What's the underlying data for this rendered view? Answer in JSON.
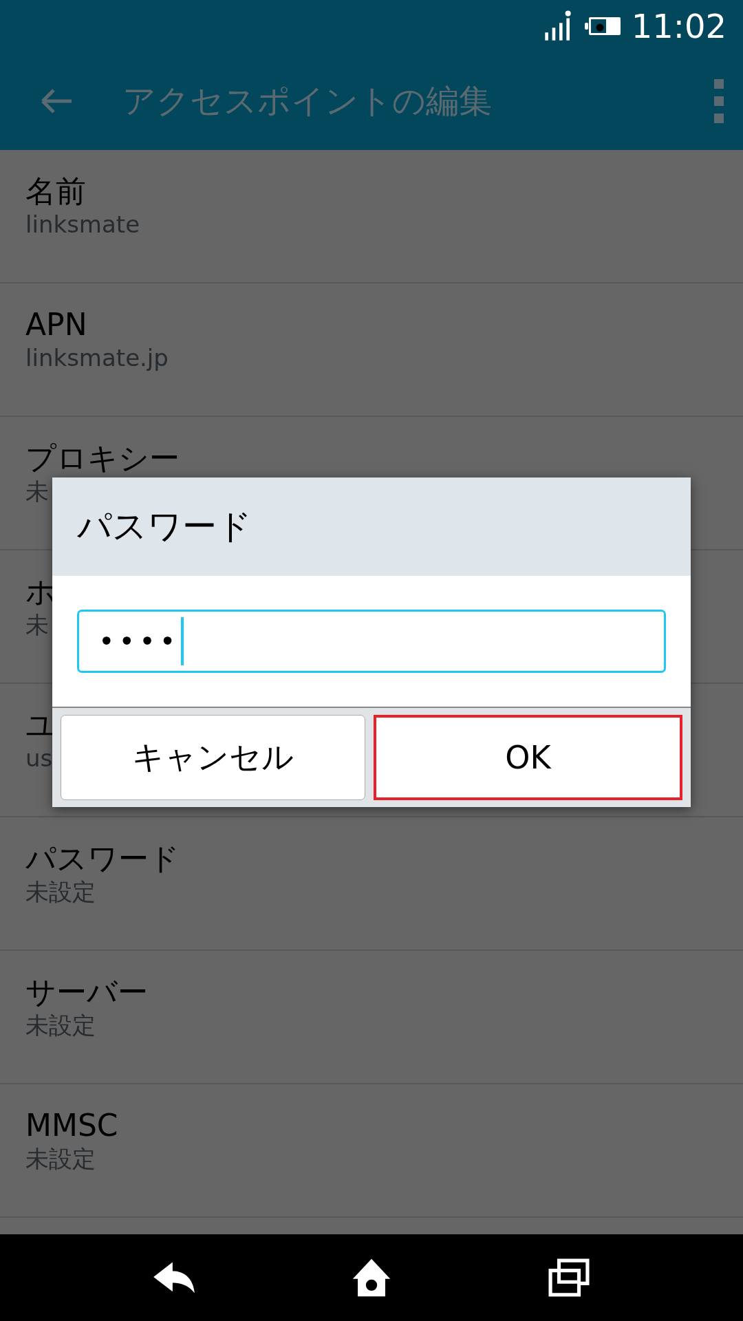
{
  "status_bar": {
    "time": "11:02"
  },
  "toolbar": {
    "title": "アクセスポイントの編集"
  },
  "settings": [
    {
      "title": "名前",
      "value": "linksmate"
    },
    {
      "title": "APN",
      "value": "linksmate.jp"
    },
    {
      "title": "プロキシー",
      "value": "未"
    },
    {
      "title": "ホ",
      "value": "未"
    },
    {
      "title": "ユ",
      "value": "us"
    },
    {
      "title": "パスワード",
      "value": "未設定"
    },
    {
      "title": "サーバー",
      "value": "未設定"
    },
    {
      "title": "MMSC",
      "value": "未設定"
    }
  ],
  "dialog": {
    "title": "パスワード",
    "field": {
      "value": "••••"
    },
    "buttons": [
      {
        "label": "キャンセル",
        "focused": false
      },
      {
        "label": "OK",
        "focused": true
      }
    ]
  }
}
